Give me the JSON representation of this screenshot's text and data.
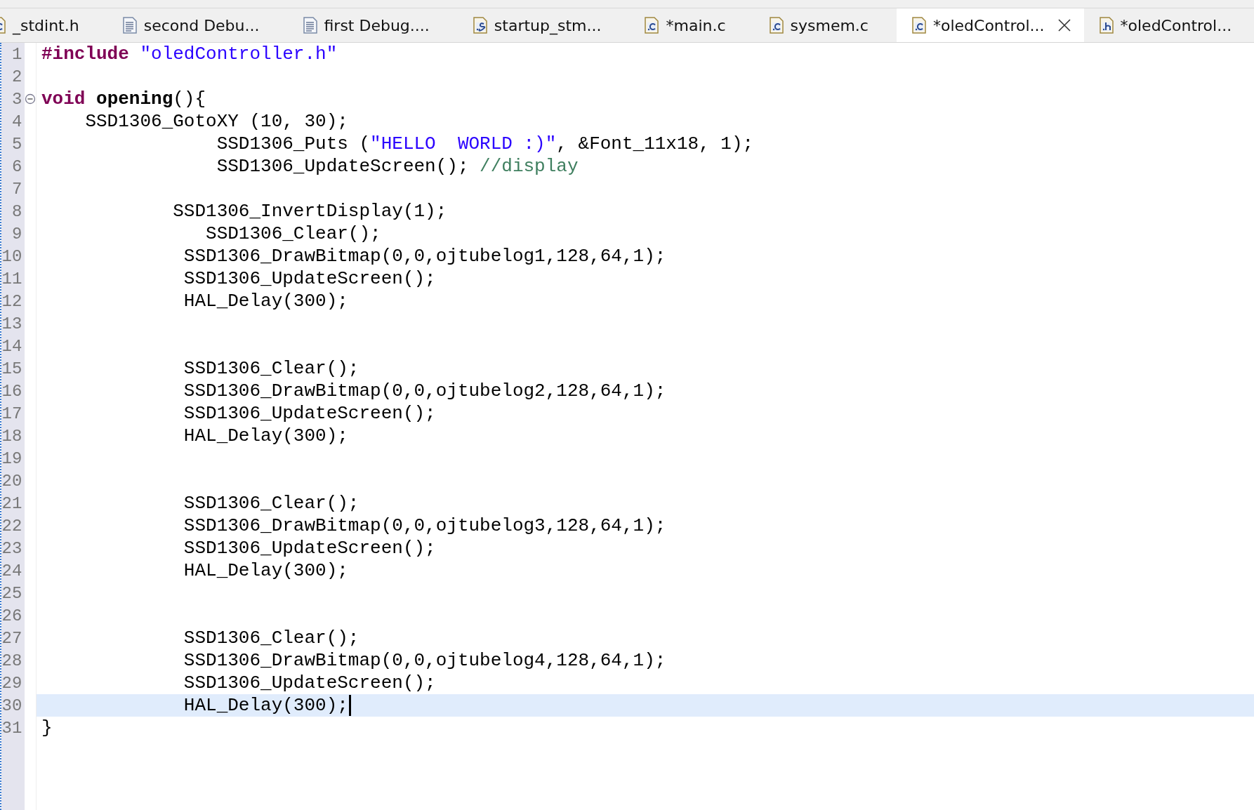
{
  "tabs": [
    {
      "label": "_stdint.h",
      "kind": "c",
      "selected": false,
      "closable": false
    },
    {
      "label": "second Debu...",
      "kind": "text",
      "selected": false,
      "closable": false
    },
    {
      "label": "first Debug....",
      "kind": "text",
      "selected": false,
      "closable": false
    },
    {
      "label": "startup_stm...",
      "kind": "asm",
      "selected": false,
      "closable": false
    },
    {
      "label": "*main.c",
      "kind": "c",
      "selected": false,
      "closable": false
    },
    {
      "label": "sysmem.c",
      "kind": "c",
      "selected": false,
      "closable": false
    },
    {
      "label": "*oledControl...",
      "kind": "c",
      "selected": true,
      "closable": true
    },
    {
      "label": "*oledControl...",
      "kind": "header",
      "selected": false,
      "closable": false
    }
  ],
  "editor": {
    "lines": [
      {
        "number": "1",
        "current": false,
        "foldable": false,
        "tokens": [
          {
            "kind": "keyword",
            "text": "#include"
          },
          {
            "kind": "string",
            "text": " \"oledController.h\""
          }
        ]
      },
      {
        "number": "2",
        "current": false,
        "foldable": false
      },
      {
        "number": "3",
        "current": false,
        "foldable": true,
        "tokens": [
          {
            "kind": "keyword",
            "text": "void"
          },
          {
            "kind": "bold",
            "text": " opening"
          },
          {
            "kind": "plain",
            "text": "(){"
          }
        ]
      },
      {
        "number": "4",
        "current": false,
        "foldable": false,
        "tokens": [
          {
            "kind": "plain",
            "text": "    SSD1306_GotoXY (10, 30);"
          }
        ]
      },
      {
        "number": "5",
        "current": false,
        "foldable": false,
        "tokens": [
          {
            "kind": "plain",
            "text": "                SSD1306_Puts ("
          },
          {
            "kind": "string",
            "text": "\"HELLO  WORLD :)\""
          },
          {
            "kind": "plain",
            "text": ", &Font_11x18, 1);"
          }
        ]
      },
      {
        "number": "6",
        "current": false,
        "foldable": false,
        "tokens": [
          {
            "kind": "plain",
            "text": "                SSD1306_UpdateScreen();"
          },
          {
            "kind": "comment",
            "text": " //display"
          }
        ]
      },
      {
        "number": "7",
        "current": false,
        "foldable": false
      },
      {
        "number": "8",
        "current": false,
        "foldable": false,
        "tokens": [
          {
            "kind": "plain",
            "text": "            SSD1306_InvertDisplay(1);"
          }
        ]
      },
      {
        "number": "9",
        "current": false,
        "foldable": false,
        "tokens": [
          {
            "kind": "plain",
            "text": "               SSD1306_Clear();"
          }
        ]
      },
      {
        "number": "10",
        "current": false,
        "foldable": false,
        "tokens": [
          {
            "kind": "plain",
            "text": "             SSD1306_DrawBitmap(0,0,ojtubelog1,128,64,1);"
          }
        ]
      },
      {
        "number": "11",
        "current": false,
        "foldable": false,
        "tokens": [
          {
            "kind": "plain",
            "text": "             SSD1306_UpdateScreen();"
          }
        ]
      },
      {
        "number": "12",
        "current": false,
        "foldable": false,
        "tokens": [
          {
            "kind": "plain",
            "text": "             HAL_Delay(300);"
          }
        ]
      },
      {
        "number": "13",
        "current": false,
        "foldable": false
      },
      {
        "number": "14",
        "current": false,
        "foldable": false
      },
      {
        "number": "15",
        "current": false,
        "foldable": false,
        "tokens": [
          {
            "kind": "plain",
            "text": "             SSD1306_Clear();"
          }
        ]
      },
      {
        "number": "16",
        "current": false,
        "foldable": false,
        "tokens": [
          {
            "kind": "plain",
            "text": "             SSD1306_DrawBitmap(0,0,ojtubelog2,128,64,1);"
          }
        ]
      },
      {
        "number": "17",
        "current": false,
        "foldable": false,
        "tokens": [
          {
            "kind": "plain",
            "text": "             SSD1306_UpdateScreen();"
          }
        ]
      },
      {
        "number": "18",
        "current": false,
        "foldable": false,
        "tokens": [
          {
            "kind": "plain",
            "text": "             HAL_Delay(300);"
          }
        ]
      },
      {
        "number": "19",
        "current": false,
        "foldable": false
      },
      {
        "number": "20",
        "current": false,
        "foldable": false
      },
      {
        "number": "21",
        "current": false,
        "foldable": false,
        "tokens": [
          {
            "kind": "plain",
            "text": "             SSD1306_Clear();"
          }
        ]
      },
      {
        "number": "22",
        "current": false,
        "foldable": false,
        "tokens": [
          {
            "kind": "plain",
            "text": "             SSD1306_DrawBitmap(0,0,ojtubelog3,128,64,1);"
          }
        ]
      },
      {
        "number": "23",
        "current": false,
        "foldable": false,
        "tokens": [
          {
            "kind": "plain",
            "text": "             SSD1306_UpdateScreen();"
          }
        ]
      },
      {
        "number": "24",
        "current": false,
        "foldable": false,
        "tokens": [
          {
            "kind": "plain",
            "text": "             HAL_Delay(300);"
          }
        ]
      },
      {
        "number": "25",
        "current": false,
        "foldable": false
      },
      {
        "number": "26",
        "current": false,
        "foldable": false
      },
      {
        "number": "27",
        "current": false,
        "foldable": false,
        "tokens": [
          {
            "kind": "plain",
            "text": "             SSD1306_Clear();"
          }
        ]
      },
      {
        "number": "28",
        "current": false,
        "foldable": false,
        "tokens": [
          {
            "kind": "plain",
            "text": "             SSD1306_DrawBitmap(0,0,ojtubelog4,128,64,1);"
          }
        ]
      },
      {
        "number": "29",
        "current": false,
        "foldable": false,
        "tokens": [
          {
            "kind": "plain",
            "text": "             SSD1306_UpdateScreen();"
          }
        ]
      },
      {
        "number": "30",
        "current": true,
        "foldable": false,
        "tokens": [
          {
            "kind": "plain",
            "text": "             HAL_Delay(300);"
          }
        ]
      },
      {
        "number": "31",
        "current": false,
        "foldable": false,
        "tokens": [
          {
            "kind": "plain",
            "text": "}"
          }
        ]
      }
    ]
  }
}
